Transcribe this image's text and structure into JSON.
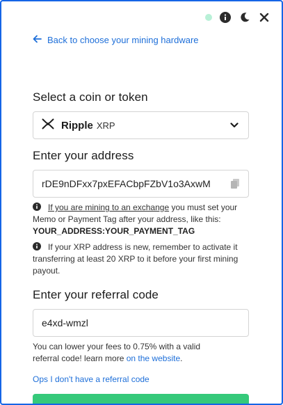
{
  "theme": {
    "accent": "#1e6fd9",
    "border": "#1565e6",
    "cta": "#35c97a",
    "status_dot": "#b8f0d7"
  },
  "topbar": {
    "icons": [
      "status-dot",
      "info-icon",
      "moon-icon",
      "close-icon"
    ]
  },
  "back_link": {
    "label": "Back to choose your mining hardware",
    "icon": "arrow-left-icon"
  },
  "coin_section": {
    "title": "Select a coin or token",
    "selected": {
      "name": "Ripple",
      "ticker": "XRP",
      "icon": "xrp-logo-icon"
    }
  },
  "address_section": {
    "title": "Enter your address",
    "value": "rDE9nDFxx7pxEFACbpFZbV1o3AxwM",
    "notes": [
      {
        "link_text": "If you are mining to an exchange",
        "text": " you must set your Memo or Payment Tag after your address, like this: ",
        "code": "YOUR_ADDRESS:YOUR_PAYMENT_TAG"
      },
      {
        "text": "If your XRP address is new, remember to activate it transferring at least 20 XRP to it before your first mining payout."
      }
    ]
  },
  "referral_section": {
    "title": "Enter your referral code",
    "value": "e4xd-wmzl",
    "hint_prefix": "You can lower your fees to 0.75% with a valid referral code! learn more ",
    "hint_link": "on the website",
    "hint_suffix": ".",
    "no_code_link": "Ops I don't have a referral code"
  }
}
